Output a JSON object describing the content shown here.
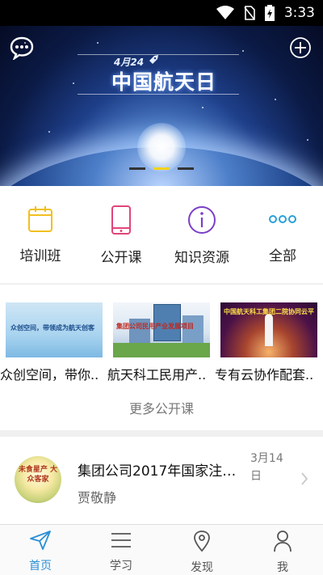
{
  "status_bar": {
    "time": "3:33"
  },
  "banner": {
    "date_text": "4月24",
    "title": "中国航天日"
  },
  "quick_menu": [
    {
      "label": "培训班",
      "icon": "calendar-icon",
      "color": "#f0c020"
    },
    {
      "label": "公开课",
      "icon": "phone-icon",
      "color": "#e0457a"
    },
    {
      "label": "知识资源",
      "icon": "info-icon",
      "color": "#7a3fc7"
    },
    {
      "label": "全部",
      "icon": "more-icon",
      "color": "#2aa0d8"
    }
  ],
  "public_courses": {
    "items": [
      {
        "name": "众创空间，带你..",
        "thumb_text": "众创空间，带领成为航天创客"
      },
      {
        "name": "航天科工民用产..",
        "thumb_text": "集团公司民用产业发展项目"
      },
      {
        "name": "专有云协作配套..",
        "thumb_text": "中国航天科工集团二院协同云平台"
      }
    ],
    "more_label": "更多公开课"
  },
  "news": {
    "title": "集团公司2017年国家注册...",
    "author": "贾敬静",
    "date": "3月14日",
    "avatar_text": "未食星产 大众客家"
  },
  "bottom_nav": [
    {
      "label": "首页",
      "icon": "send-icon",
      "active": true
    },
    {
      "label": "学习",
      "icon": "menu-icon",
      "active": false
    },
    {
      "label": "发现",
      "icon": "location-pin-icon",
      "active": false
    },
    {
      "label": "我",
      "icon": "person-icon",
      "active": false
    }
  ],
  "colors": {
    "accent": "#2a8fd6",
    "active_dot": "#f2d21a"
  }
}
